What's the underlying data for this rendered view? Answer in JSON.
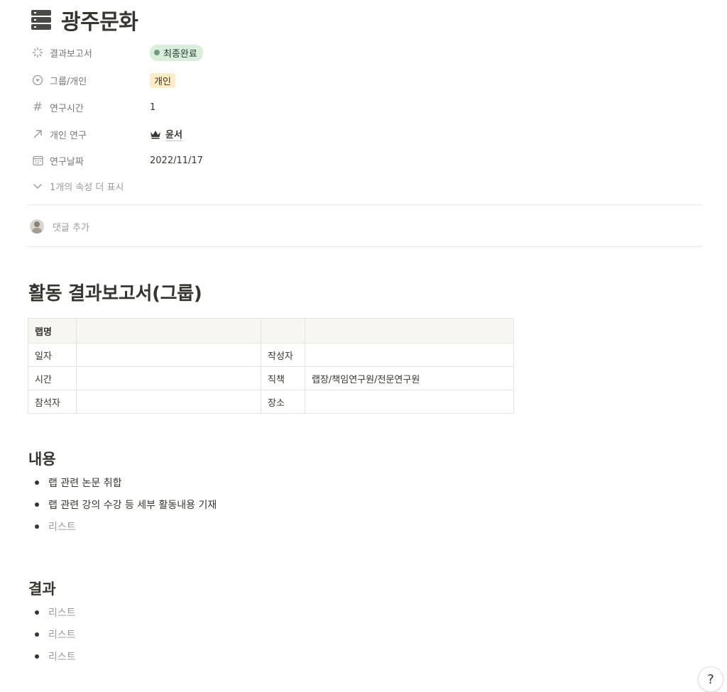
{
  "page": {
    "title": "광주문화",
    "icon": "database-stack-icon"
  },
  "properties": [
    {
      "icon": "loading-spinner-icon",
      "name": "결과보고서",
      "value": "최종완료",
      "kind": "status",
      "color": "#dbeddb"
    },
    {
      "icon": "chevron-circle-down-icon",
      "name": "그룹/개인",
      "value": "개인",
      "kind": "select",
      "color": "#fdecc8"
    },
    {
      "icon": "hash-icon",
      "name": "연구시간",
      "value": "1",
      "kind": "number"
    },
    {
      "icon": "arrow-up-right-icon",
      "name": "개인 연구",
      "value": "윤서",
      "kind": "relation",
      "value_icon": "crown-icon"
    },
    {
      "icon": "calendar-icon",
      "name": "연구날짜",
      "value": "2022/11/17",
      "kind": "date"
    }
  ],
  "more_properties": "1개의 속성 더 표시",
  "comment": {
    "placeholder": "댓글 추가"
  },
  "heading1": "활동 결과보고서(그룹)",
  "table": {
    "rows": [
      [
        "랩명",
        "",
        "",
        ""
      ],
      [
        "일자",
        "",
        "작성자",
        ""
      ],
      [
        "시간",
        "",
        "직책",
        "랩장/책임연구원/전문연구원"
      ],
      [
        "참석자",
        "",
        "장소",
        ""
      ]
    ]
  },
  "section_contents": {
    "heading": "내용",
    "items": [
      "랩 관련 논문 취합",
      "랩 관련 강의 수강 등 세부 활동내용 기재",
      "리스트"
    ]
  },
  "section_results": {
    "heading": "결과",
    "items": [
      "리스트",
      "리스트",
      "리스트"
    ]
  },
  "help": {
    "label": "?"
  }
}
